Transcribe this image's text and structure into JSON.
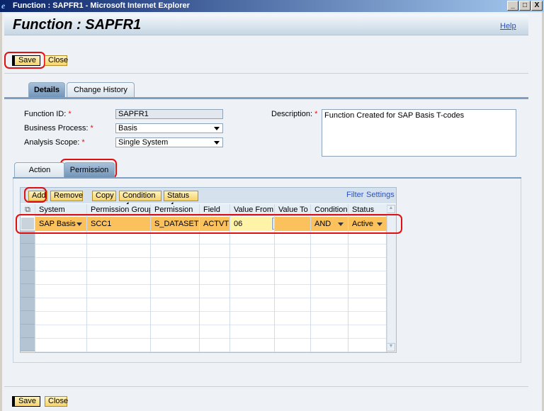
{
  "window": {
    "title": "Function : SAPFR1 - Microsoft Internet Explorer",
    "min": "_",
    "max": "□",
    "close": "X"
  },
  "header": {
    "title": "Function : SAPFR1",
    "help": "Help"
  },
  "toolbar": {
    "save": "Save",
    "close": "Close"
  },
  "tabs": [
    {
      "label": "Details"
    },
    {
      "label": "Change History"
    }
  ],
  "form": {
    "function_id_label": "Function ID:",
    "function_id": "SAPFR1",
    "business_process_label": "Business Process:",
    "business_process": "Basis",
    "analysis_scope_label": "Analysis Scope:",
    "analysis_scope": "Single System",
    "description_label": "Description:",
    "description": "Function Created for SAP Basis T-codes",
    "required": "*"
  },
  "inner_tabs": [
    {
      "label": "Action"
    },
    {
      "label": "Permission"
    }
  ],
  "table_toolbar": {
    "add": "Add",
    "remove": "Remove",
    "copy": "Copy",
    "condition": "Condition",
    "status": "Status",
    "filter": "Filter",
    "settings": "Settings"
  },
  "table": {
    "columns": [
      "System",
      "Permission Group",
      "Permission",
      "Field",
      "Value From",
      "Value To",
      "Condition",
      "Status"
    ],
    "rows": [
      {
        "system": "SAP Basis",
        "permission_group": "SCC1",
        "permission": "S_DATASET",
        "field": "ACTVT",
        "value_from": "06",
        "value_to": "",
        "condition": "AND",
        "status": "Active"
      }
    ]
  },
  "footer": {
    "save": "Save",
    "close": "Close"
  }
}
